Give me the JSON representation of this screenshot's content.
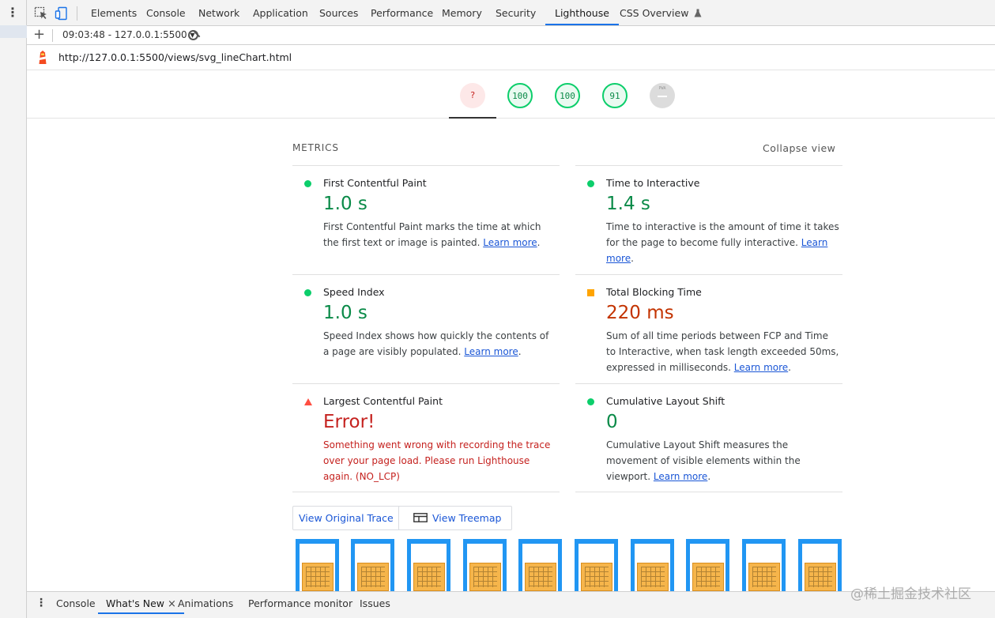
{
  "devtools": {
    "tabs": [
      "Elements",
      "Console",
      "Network",
      "Application",
      "Sources",
      "Performance",
      "Memory",
      "Security",
      "Lighthouse",
      "CSS Overview"
    ],
    "active_tab": "Lighthouse"
  },
  "toolbar": {
    "add_label": "+",
    "session": "09:03:48 - 127.0.0.1:5500 ▾"
  },
  "url": "http://127.0.0.1:5500/views/svg_lineChart.html",
  "gauges": {
    "performance": "?",
    "accessibility": "100",
    "best_practices": "100",
    "seo": "91",
    "pwa": "PWA"
  },
  "metrics": {
    "header": "METRICS",
    "collapse": "Collapse view",
    "fcp": {
      "title": "First Contentful Paint",
      "value": "1.0 s",
      "desc": "First Contentful Paint marks the time at which the first text or image is painted.",
      "link": "Learn more"
    },
    "tti": {
      "title": "Time to Interactive",
      "value": "1.4 s",
      "desc": "Time to interactive is the amount of time it takes for the page to become fully interactive.",
      "link": "Learn more"
    },
    "si": {
      "title": "Speed Index",
      "value": "1.0 s",
      "desc": "Speed Index shows how quickly the contents of a page are visibly populated.",
      "link": "Learn more"
    },
    "tbt": {
      "title": "Total Blocking Time",
      "value": "220 ms",
      "desc": "Sum of all time periods between FCP and Time to Interactive, when task length exceeded 50ms, expressed in milliseconds.",
      "link": "Learn more"
    },
    "lcp": {
      "title": "Largest Contentful Paint",
      "value": "Error!",
      "desc": "Something went wrong with recording the trace over your page load. Please run Lighthouse again. (NO_LCP)"
    },
    "cls": {
      "title": "Cumulative Layout Shift",
      "value": "0",
      "desc": "Cumulative Layout Shift measures the movement of visible elements within the viewport.",
      "link": "Learn more"
    }
  },
  "buttons": {
    "view_trace": "View Original Trace",
    "view_treemap": "View Treemap"
  },
  "drawer": {
    "tabs": [
      "Console",
      "What's New",
      "Animations",
      "Performance monitor",
      "Issues"
    ],
    "active_tab": "What's New",
    "close": "×"
  },
  "watermark": "@稀土掘金技术社区",
  "colors": {
    "pass": "#0cce6b",
    "average": "#ffa400",
    "fail": "#ff4e42",
    "link": "#1a56d6",
    "accent": "#1a73e8"
  }
}
